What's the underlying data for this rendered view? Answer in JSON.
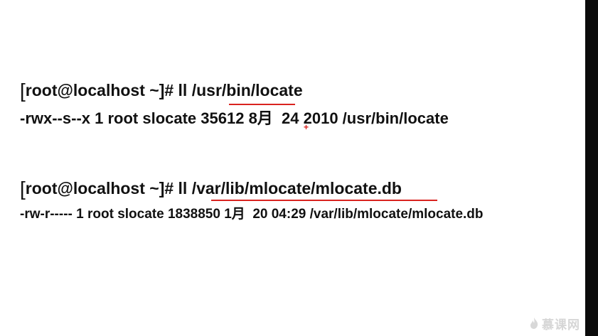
{
  "terminal": {
    "block1": {
      "prompt_bracket": "[",
      "command_rest": "root@localhost ~]# ll /usr/bin/locate",
      "output": "-rwx--s--x 1 root slocate 35612 8月  24 2010 /usr/bin/locate"
    },
    "block2": {
      "prompt_bracket": "[",
      "command_rest": "root@localhost ~]# ll /var/lib/mlocate/mlocate.db",
      "output": "-rw-r----- 1 root slocate 1838850 1月  20 04:29 /var/lib/mlocate/mlocate.db"
    }
  },
  "cursor": {
    "glyph": "+"
  },
  "watermark": {
    "text": "慕课网",
    "icon": "flame-icon"
  },
  "colors": {
    "background": "#ffffff",
    "text": "#111111",
    "underline": "#d9231f",
    "watermark": "#d6d6d6"
  }
}
